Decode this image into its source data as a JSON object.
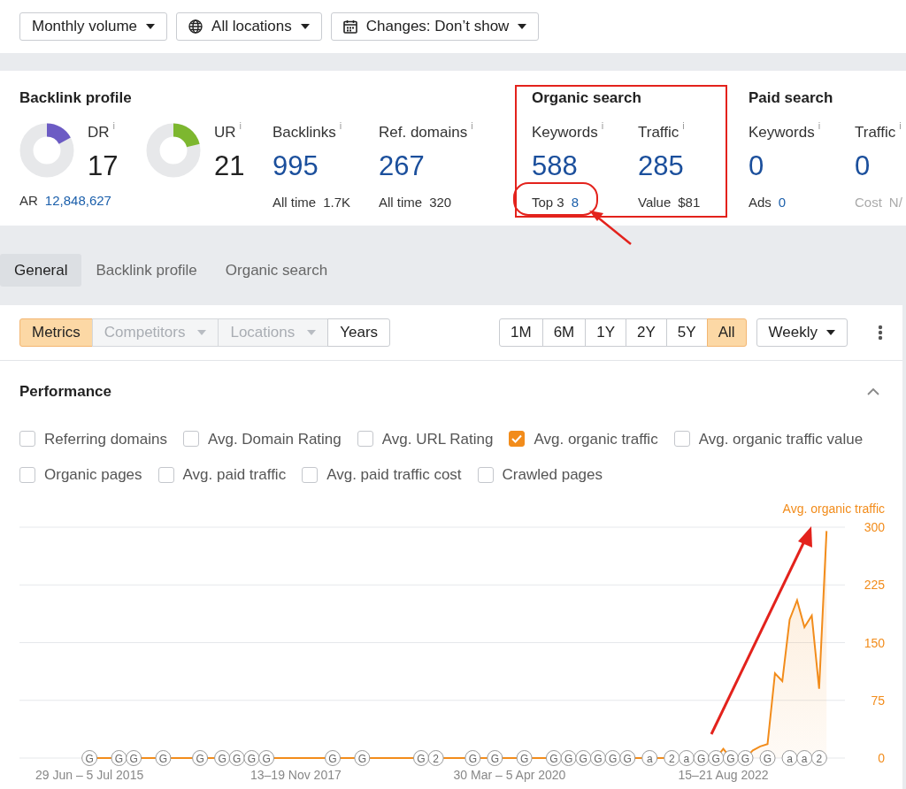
{
  "filters": [
    {
      "label": "Monthly volume",
      "kind": "plain"
    },
    {
      "label": "All locations",
      "kind": "globe"
    },
    {
      "label": "Changes: Don’t show",
      "kind": "calendar"
    }
  ],
  "sections": [
    {
      "title": "Backlink profile",
      "highlighted": false,
      "metrics": [
        {
          "kind": "gauge",
          "label": "DR",
          "info": "i",
          "value": "17",
          "level": 0.17,
          "color": "#6c5bc4",
          "sub_label": "AR",
          "sub_value": "12,848,627",
          "sub_link": true,
          "muted": false
        },
        {
          "kind": "gauge",
          "label": "UR",
          "info": "i",
          "value": "21",
          "level": 0.21,
          "color": "#7db72f"
        },
        {
          "kind": "stat",
          "label": "Backlinks",
          "info": "i",
          "value": "995",
          "sub_label": "All time",
          "sub_value": "1.7K",
          "sub_link": false,
          "muted": false
        },
        {
          "kind": "stat",
          "label": "Ref. domains",
          "info": "i",
          "value": "267",
          "sub_label": "All time",
          "sub_value": "320",
          "sub_link": false,
          "muted": false
        }
      ]
    },
    {
      "title": "Organic search",
      "highlighted": true,
      "metrics": [
        {
          "kind": "stat",
          "label": "Keywords",
          "info": "i",
          "value": "588",
          "sub_label": "Top 3",
          "sub_value": "8",
          "sub_link": true,
          "muted": false
        },
        {
          "kind": "stat",
          "label": "Traffic",
          "info": "i",
          "value": "285",
          "sub_label": "Value",
          "sub_value": "$81",
          "sub_link": false,
          "muted": false
        }
      ]
    },
    {
      "title": "Paid search",
      "highlighted": false,
      "metrics": [
        {
          "kind": "stat",
          "label": "Keywords",
          "info": "i",
          "value": "0",
          "sub_label": "Ads",
          "sub_value": "0",
          "sub_link": true,
          "muted": false
        },
        {
          "kind": "stat",
          "label": "Traffic",
          "info": "i",
          "value": "0",
          "sub_label": "Cost",
          "sub_value": "N/",
          "sub_link": false,
          "muted": true
        }
      ]
    }
  ],
  "tabs": [
    {
      "label": "General",
      "selected": true
    },
    {
      "label": "Backlink profile",
      "selected": false
    },
    {
      "label": "Organic search",
      "selected": false
    }
  ],
  "views": [
    {
      "label": "Metrics",
      "selected": true,
      "disabled": false,
      "dropdown": false
    },
    {
      "label": "Competitors",
      "selected": false,
      "disabled": true,
      "dropdown": true
    },
    {
      "label": "Locations",
      "selected": false,
      "disabled": true,
      "dropdown": true
    },
    {
      "label": "Years",
      "selected": false,
      "disabled": false,
      "dropdown": false
    }
  ],
  "periods": [
    {
      "label": "1M",
      "selected": false
    },
    {
      "label": "6M",
      "selected": false
    },
    {
      "label": "1Y",
      "selected": false
    },
    {
      "label": "2Y",
      "selected": false
    },
    {
      "label": "5Y",
      "selected": false
    },
    {
      "label": "All",
      "selected": true
    }
  ],
  "interval": {
    "label": "Weekly"
  },
  "performance": {
    "title": "Performance",
    "expanded": true,
    "metrics": [
      {
        "label": "Referring domains",
        "checked": false
      },
      {
        "label": "Avg. Domain Rating",
        "checked": false
      },
      {
        "label": "Avg. URL Rating",
        "checked": false
      },
      {
        "label": "Avg. organic traffic",
        "checked": true
      },
      {
        "label": "Avg. organic traffic value",
        "checked": false
      },
      {
        "label": "Organic pages",
        "checked": false
      },
      {
        "label": "Avg. paid traffic",
        "checked": false
      },
      {
        "label": "Avg. paid traffic cost",
        "checked": false
      },
      {
        "label": "Crawled pages",
        "checked": false
      }
    ],
    "chart_data": {
      "type": "area",
      "grid": true,
      "categories": [
        null,
        null,
        null,
        null,
        null,
        null,
        null,
        null,
        null,
        "29 Jun – 5 Jul 2015",
        null,
        null,
        null,
        null,
        null,
        null,
        null,
        null,
        null,
        null,
        null,
        null,
        null,
        null,
        null,
        null,
        null,
        null,
        null,
        null,
        null,
        null,
        null,
        null,
        null,
        null,
        null,
        "13–19 Nov 2017",
        null,
        null,
        null,
        null,
        null,
        null,
        null,
        null,
        null,
        null,
        null,
        null,
        null,
        null,
        null,
        null,
        null,
        null,
        null,
        null,
        null,
        null,
        null,
        null,
        null,
        null,
        null,
        null,
        "30 Mar – 5 Apr 2020",
        null,
        null,
        null,
        null,
        null,
        null,
        null,
        null,
        null,
        null,
        null,
        null,
        null,
        null,
        null,
        null,
        null,
        null,
        null,
        null,
        null,
        null,
        null,
        null,
        null,
        null,
        null,
        null,
        "15–21 Aug 2022",
        null,
        null,
        null,
        null,
        null,
        null,
        null,
        null,
        null,
        null,
        null,
        null,
        null,
        null,
        null,
        null
      ],
      "series": [
        {
          "name": "Avg. organic traffic",
          "color": "#f28c1b",
          "values": [
            null,
            null,
            null,
            null,
            null,
            null,
            null,
            null,
            0,
            0,
            0,
            0,
            0,
            0,
            0,
            0,
            0,
            0,
            0,
            0,
            0,
            0,
            0,
            0,
            0,
            0,
            0,
            0,
            0,
            0,
            0,
            0,
            0,
            0,
            0,
            0,
            0,
            0,
            0,
            0,
            0,
            0,
            0,
            0,
            0,
            0,
            0,
            0,
            0,
            0,
            0,
            0,
            0,
            0,
            0,
            0,
            0,
            0,
            0,
            0,
            0,
            0,
            0,
            0,
            0,
            0,
            0,
            0,
            0,
            0,
            0,
            0,
            0,
            0,
            0,
            0,
            0,
            0,
            0,
            0,
            0,
            0,
            0,
            0,
            0,
            0,
            0,
            0,
            0,
            0,
            0,
            0,
            0,
            0,
            0,
            12,
            0,
            0,
            0,
            10,
            15,
            18,
            110,
            100,
            180,
            205,
            170,
            185,
            90,
            295,
            null,
            null
          ]
        }
      ],
      "ylim": [
        0,
        300
      ],
      "yticks": [
        0,
        75,
        150,
        225,
        300
      ]
    },
    "events": [
      {
        "label": "G"
      },
      {
        "label": "G"
      },
      {
        "label": "G"
      },
      {
        "label": "G"
      },
      {
        "label": "G"
      },
      {
        "label": "G"
      },
      {
        "label": "G"
      },
      {
        "label": "G"
      },
      {
        "label": "G"
      },
      {
        "label": "G"
      },
      {
        "label": "G"
      },
      {
        "label": "G"
      },
      {
        "label": "2"
      },
      {
        "label": "G"
      },
      {
        "label": "G"
      },
      {
        "label": "G"
      },
      {
        "label": "G"
      },
      {
        "label": "G"
      },
      {
        "label": "G"
      },
      {
        "label": "G"
      },
      {
        "label": "G"
      },
      {
        "label": "G"
      },
      {
        "label": "a"
      },
      {
        "label": "2"
      },
      {
        "label": "a"
      },
      {
        "label": "G"
      },
      {
        "label": "G"
      },
      {
        "label": "G"
      },
      {
        "label": "G"
      },
      {
        "label": "G"
      },
      {
        "label": "a"
      },
      {
        "label": "a"
      },
      {
        "label": "2"
      }
    ]
  }
}
